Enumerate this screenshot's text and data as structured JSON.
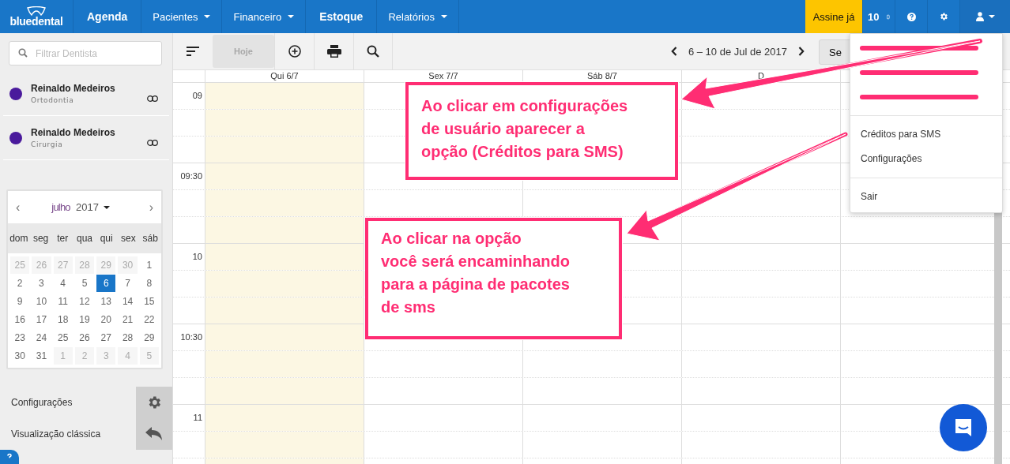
{
  "topbar": {
    "logo": "bluedental",
    "nav": [
      {
        "label": "Agenda",
        "kind": "link"
      },
      {
        "label": "Pacientes",
        "kind": "menu"
      },
      {
        "label": "Financeiro",
        "kind": "menu"
      },
      {
        "label": "Estoque",
        "kind": "link"
      },
      {
        "label": "Relatórios",
        "kind": "menu"
      }
    ],
    "subscribe": "Assine já",
    "credits": "10"
  },
  "sidebar": {
    "search": {
      "placeholder": "Filtrar Dentista"
    },
    "dentists": [
      {
        "name": "Reinaldo Medeiros",
        "specialty": "Ortodontia",
        "color": "#4a1a9c"
      },
      {
        "name": "Reinaldo Medeiros",
        "specialty": "Cirurgia",
        "color": "#4a1a9c"
      }
    ],
    "mini_calendar": {
      "prev": "‹",
      "next": "›",
      "month": "julho",
      "year": "2017",
      "weekdays": [
        "dom",
        "seg",
        "ter",
        "qua",
        "qui",
        "sex",
        "sáb"
      ],
      "weeks": [
        [
          {
            "day": "25",
            "muted": true,
            "selected": false
          },
          {
            "day": "26",
            "muted": true,
            "selected": false
          },
          {
            "day": "27",
            "muted": true,
            "selected": false
          },
          {
            "day": "28",
            "muted": true,
            "selected": false
          },
          {
            "day": "29",
            "muted": true,
            "selected": false
          },
          {
            "day": "30",
            "muted": true,
            "selected": false
          },
          {
            "day": "1",
            "muted": false,
            "selected": false
          }
        ],
        [
          {
            "day": "2",
            "muted": false,
            "selected": false
          },
          {
            "day": "3",
            "muted": false,
            "selected": false
          },
          {
            "day": "4",
            "muted": false,
            "selected": false
          },
          {
            "day": "5",
            "muted": false,
            "selected": false
          },
          {
            "day": "6",
            "muted": false,
            "selected": true
          },
          {
            "day": "7",
            "muted": false,
            "selected": false
          },
          {
            "day": "8",
            "muted": false,
            "selected": false
          }
        ],
        [
          {
            "day": "9",
            "muted": false,
            "selected": false
          },
          {
            "day": "10",
            "muted": false,
            "selected": false
          },
          {
            "day": "11",
            "muted": false,
            "selected": false
          },
          {
            "day": "12",
            "muted": false,
            "selected": false
          },
          {
            "day": "13",
            "muted": false,
            "selected": false
          },
          {
            "day": "14",
            "muted": false,
            "selected": false
          },
          {
            "day": "15",
            "muted": false,
            "selected": false
          }
        ],
        [
          {
            "day": "16",
            "muted": false,
            "selected": false
          },
          {
            "day": "17",
            "muted": false,
            "selected": false
          },
          {
            "day": "18",
            "muted": false,
            "selected": false
          },
          {
            "day": "19",
            "muted": false,
            "selected": false
          },
          {
            "day": "20",
            "muted": false,
            "selected": false
          },
          {
            "day": "21",
            "muted": false,
            "selected": false
          },
          {
            "day": "22",
            "muted": false,
            "selected": false
          }
        ],
        [
          {
            "day": "23",
            "muted": false,
            "selected": false
          },
          {
            "day": "24",
            "muted": false,
            "selected": false
          },
          {
            "day": "25",
            "muted": false,
            "selected": false
          },
          {
            "day": "26",
            "muted": false,
            "selected": false
          },
          {
            "day": "27",
            "muted": false,
            "selected": false
          },
          {
            "day": "28",
            "muted": false,
            "selected": false
          },
          {
            "day": "29",
            "muted": false,
            "selected": false
          }
        ],
        [
          {
            "day": "30",
            "muted": false,
            "selected": false
          },
          {
            "day": "31",
            "muted": false,
            "selected": false
          },
          {
            "day": "1",
            "muted": true,
            "selected": false
          },
          {
            "day": "2",
            "muted": true,
            "selected": false
          },
          {
            "day": "3",
            "muted": true,
            "selected": false
          },
          {
            "day": "4",
            "muted": true,
            "selected": false
          },
          {
            "day": "5",
            "muted": true,
            "selected": false
          }
        ]
      ]
    },
    "links": [
      {
        "label": "Configurações",
        "kind": "settings"
      },
      {
        "label": "Visualização clássica",
        "kind": "back"
      }
    ]
  },
  "toolbar": {
    "today": {
      "label": "Hoje",
      "disabled": true
    },
    "range": "6 – 10 de Jul de 2017",
    "view": "Se"
  },
  "calendar": {
    "columns": [
      {
        "label": "Qui 6/7",
        "today": true
      },
      {
        "label": "Sex 7/7",
        "today": false
      },
      {
        "label": "Sáb 8/7",
        "today": false
      },
      {
        "label": "D",
        "today": false
      }
    ],
    "times": [
      "09",
      "09:30",
      "10",
      "10:30",
      "11"
    ]
  },
  "user_menu": [
    {
      "kind": "redacted"
    },
    {
      "kind": "redacted"
    },
    {
      "kind": "redacted"
    },
    {
      "kind": "divider"
    },
    {
      "kind": "item",
      "label": "Créditos para SMS"
    },
    {
      "kind": "item",
      "label": "Configurações"
    },
    {
      "kind": "divider"
    },
    {
      "kind": "item",
      "label": "Sair"
    }
  ],
  "annotations": [
    {
      "text": "Ao clicar em configurações\nde usuário aparecer a\nopção (Créditos para SMS)"
    },
    {
      "text": "Ao clicar na opção\nvocê será encaminhando\npara a página de pacotes\nde sms"
    }
  ]
}
